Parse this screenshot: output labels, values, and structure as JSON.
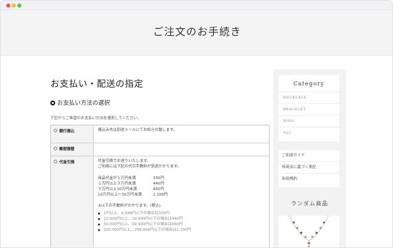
{
  "page": {
    "title": "ご注文のお手続き"
  },
  "main": {
    "heading": "お支払い・配送の指定",
    "section_title": "お支払い方法の選択",
    "intro": "下記からご希望のお支払い方法を選択してください。",
    "methods": [
      {
        "label": "銀行振込",
        "description": "振込み先は別途メールにてお知らせ致します。"
      },
      {
        "label": "郵便振替",
        "description": ""
      },
      {
        "label": "代金引換",
        "line1": "代金引換でお送りいたします。",
        "line2": "ご利用には下記の代引手数料が別途かかります。",
        "fees": [
          {
            "range": "商品代金が１万円未満",
            "fee": "330円"
          },
          {
            "range": "１万円以上３万円未満",
            "fee": "440円"
          },
          {
            "range": "３万円以上10万円未満",
            "fee": "660円"
          },
          {
            "range": "10万円以上〜30万円未満",
            "fee": "1,100円"
          }
        ],
        "extra_note": "※以下の手数料がかかります。(税込)",
        "notes": [
          "1円以上、9,999円以下の場合は330円",
          "10,000円以上、29,999円以下の場合は440円",
          "30,000円以上、99,999円以下の場合は660円",
          "100,000円以上、299,999円以下の場合は1,100円"
        ]
      }
    ]
  },
  "sidebar": {
    "category_title": "Category",
    "categories": [
      "NECKLACE",
      "BRACELET",
      "RING",
      "ALL"
    ],
    "links": [
      "ご利用ガイド",
      "特商法に基づく表記",
      "利用規約"
    ],
    "random_title": "ランダム商品"
  },
  "colors": {
    "hero_bg": "#f4f4f4",
    "sidebar_bg": "#f2f2f2"
  }
}
